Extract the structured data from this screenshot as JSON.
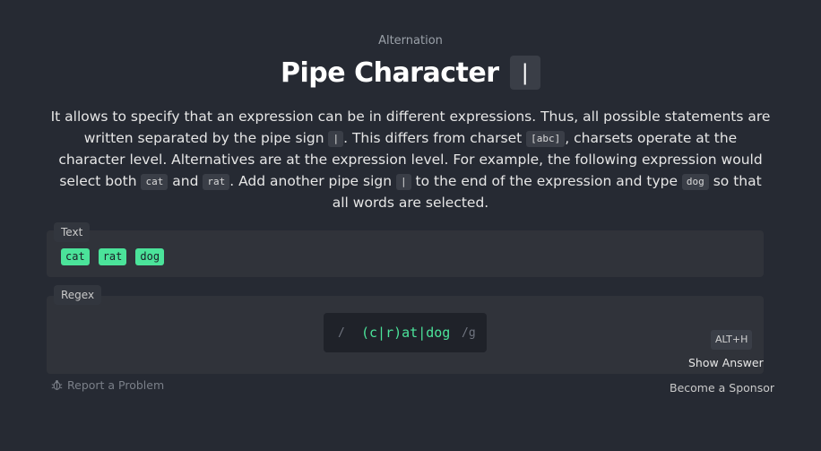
{
  "header": {
    "subtitle": "Alternation",
    "title": "Pipe Character",
    "title_code": "|"
  },
  "description": {
    "p1": "It allows to specify that an expression can be in different expressions. Thus, all possible statements are written separated by the pipe sign ",
    "code1": "|",
    "p2": ". This differs from charset ",
    "code2": "[abc]",
    "p3": ", charsets operate at the character level. Alternatives are at the expression level. For example, the following expression would select both ",
    "code3": "cat",
    "p4": " and ",
    "code4": "rat",
    "p5": ". Add another pipe sign ",
    "code5": "|",
    "p6": " to the end of the expression and type ",
    "code6": "dog",
    "p7": " so that all words are selected."
  },
  "text_panel": {
    "label": "Text",
    "matches": [
      "cat",
      "rat",
      "dog"
    ]
  },
  "regex_panel": {
    "label": "Regex",
    "open_slash": "/",
    "value": "(c|r)at|dog",
    "flags": "/g"
  },
  "hint": {
    "shortcut": "ALT+H",
    "show_answer": "Show Answer"
  },
  "footer": {
    "report": "Report a Problem",
    "sponsor": "Become a Sponsor"
  },
  "colors": {
    "background": "#262a33",
    "match": "#4be39a",
    "panel": "#30333a"
  }
}
